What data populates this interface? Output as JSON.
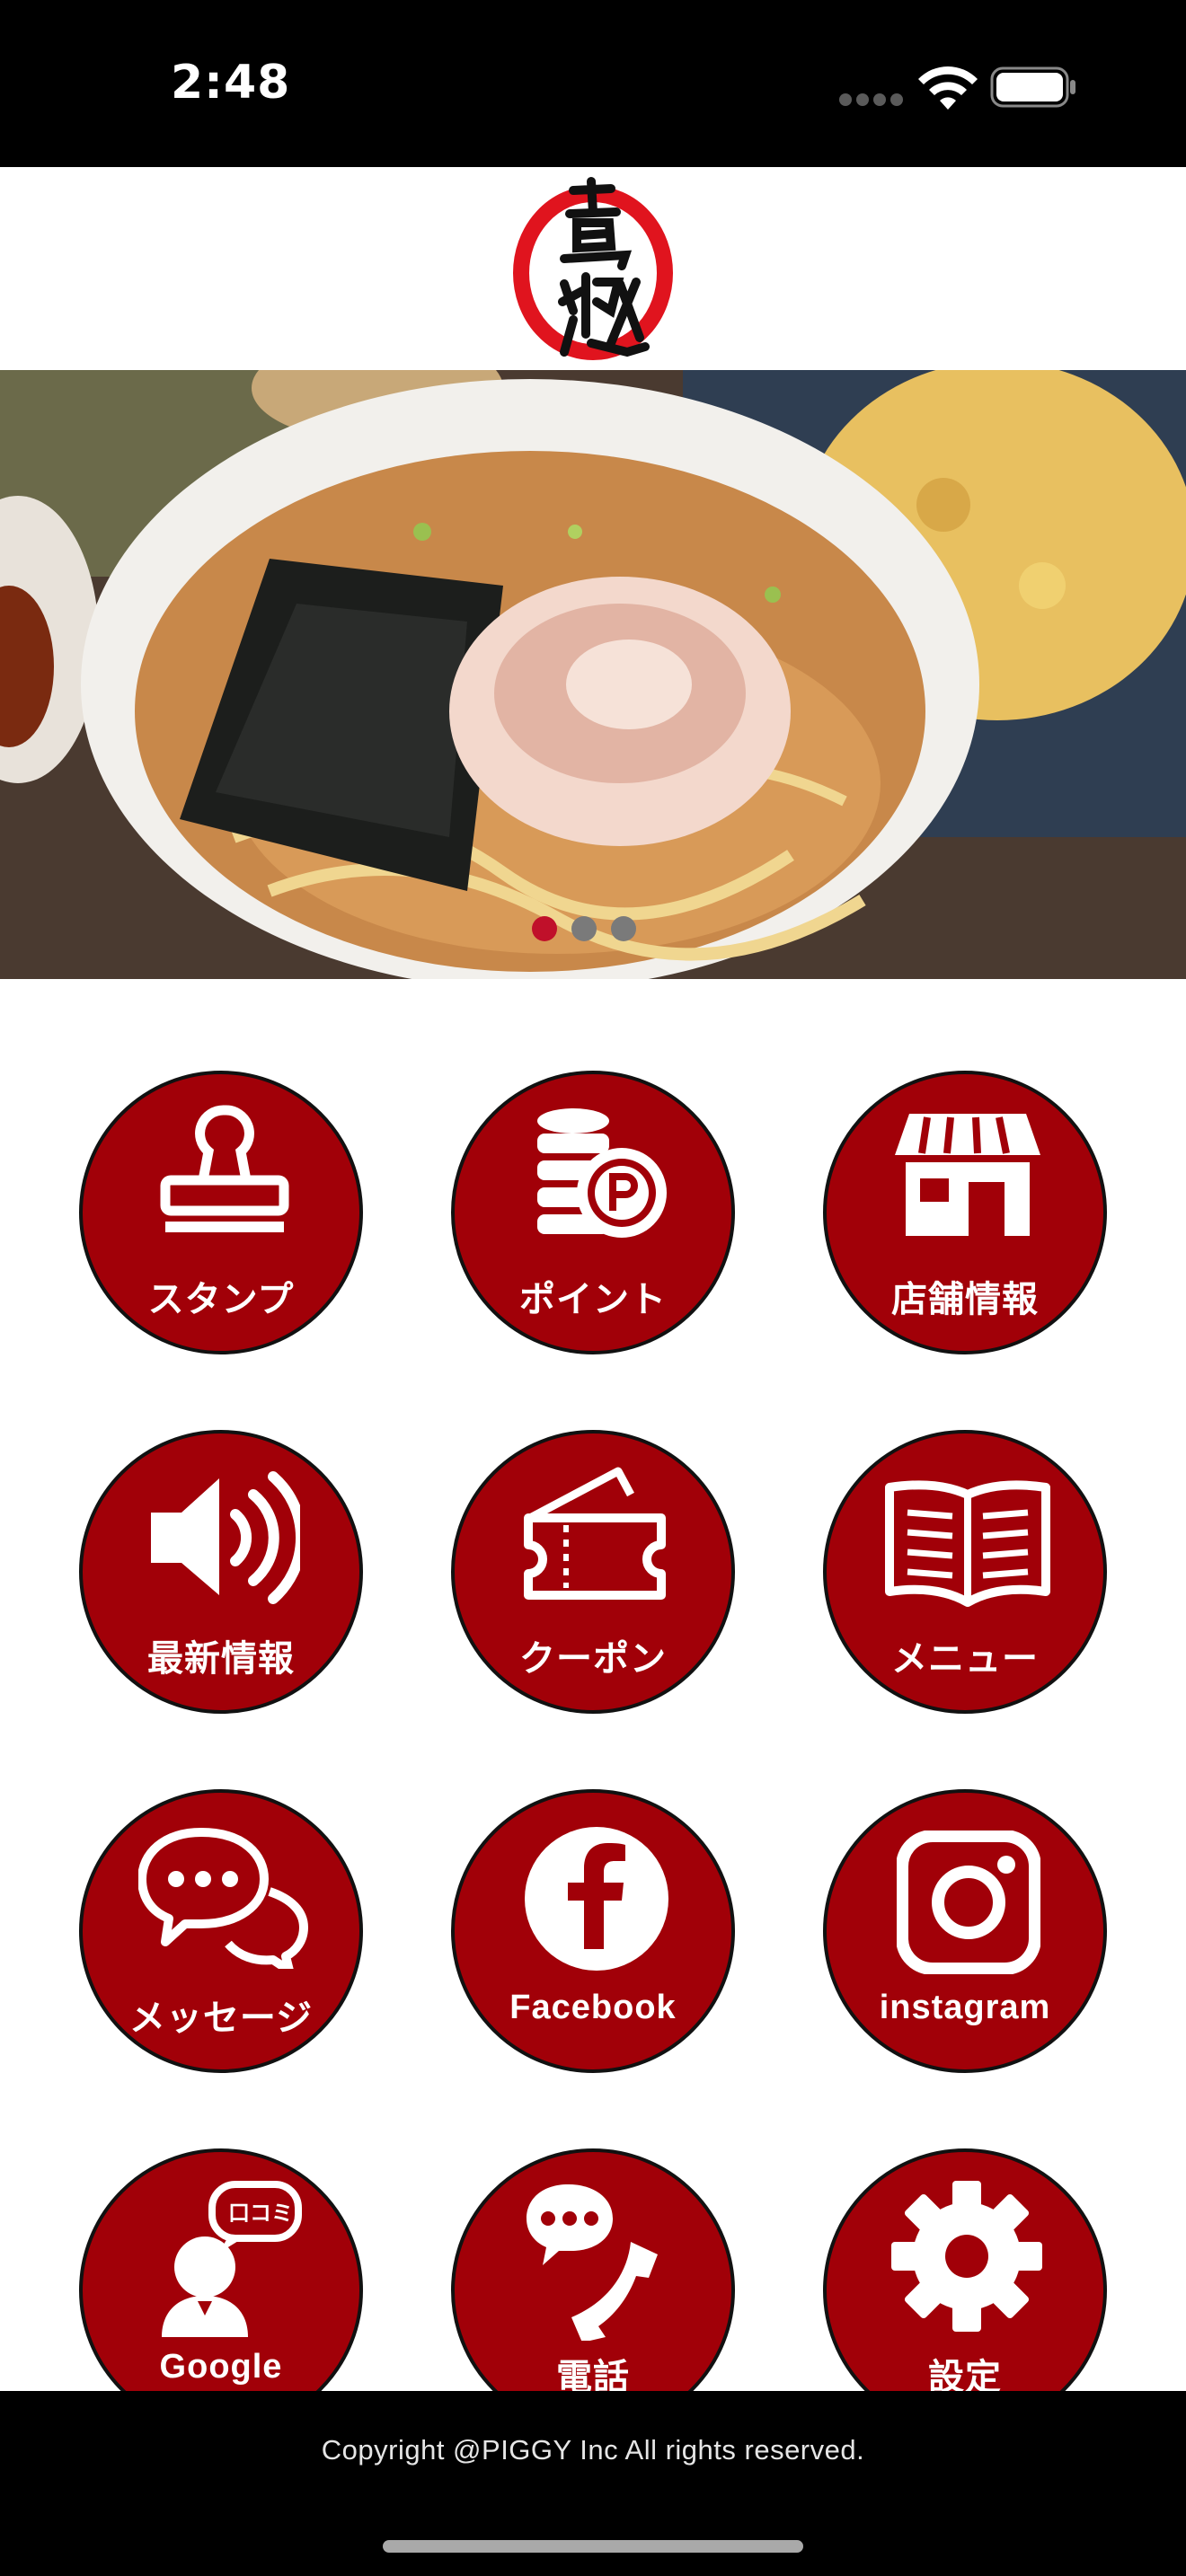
{
  "status_bar": {
    "time": "2:48",
    "icons": [
      "cellular-signal-icon",
      "wifi-icon",
      "battery-icon"
    ]
  },
  "header": {
    "logo_icon": "restaurant-logo-icon"
  },
  "hero": {
    "image": "ramen-and-fried-rice-photo",
    "carousel_dots": 3,
    "active_dot": 0
  },
  "menu": {
    "items": [
      {
        "label": "スタンプ",
        "icon": "stamp-icon"
      },
      {
        "label": "ポイント",
        "icon": "coins-point-icon"
      },
      {
        "label": "店舗情報",
        "icon": "store-icon"
      },
      {
        "label": "最新情報",
        "icon": "speaker-icon"
      },
      {
        "label": "クーポン",
        "icon": "coupon-icon"
      },
      {
        "label": "メニュー",
        "icon": "open-book-icon"
      },
      {
        "label": "メッセージ",
        "icon": "chat-bubbles-icon"
      },
      {
        "label": "Facebook",
        "icon": "facebook-icon"
      },
      {
        "label": "instagram",
        "icon": "instagram-icon"
      },
      {
        "label": "Google",
        "icon": "google-review-icon",
        "badge": "口コミ"
      },
      {
        "label": "電話",
        "icon": "phone-icon"
      },
      {
        "label": "設定",
        "icon": "gear-icon"
      }
    ]
  },
  "footer": {
    "copyright": "Copyright @PIGGY Inc All rights reserved."
  },
  "colors": {
    "accent": "#a10008",
    "status_bar_bg": "#000000",
    "footer_bg": "#000000",
    "active_dot": "#c0102a",
    "inactive_dot": "#7a7a7a"
  }
}
